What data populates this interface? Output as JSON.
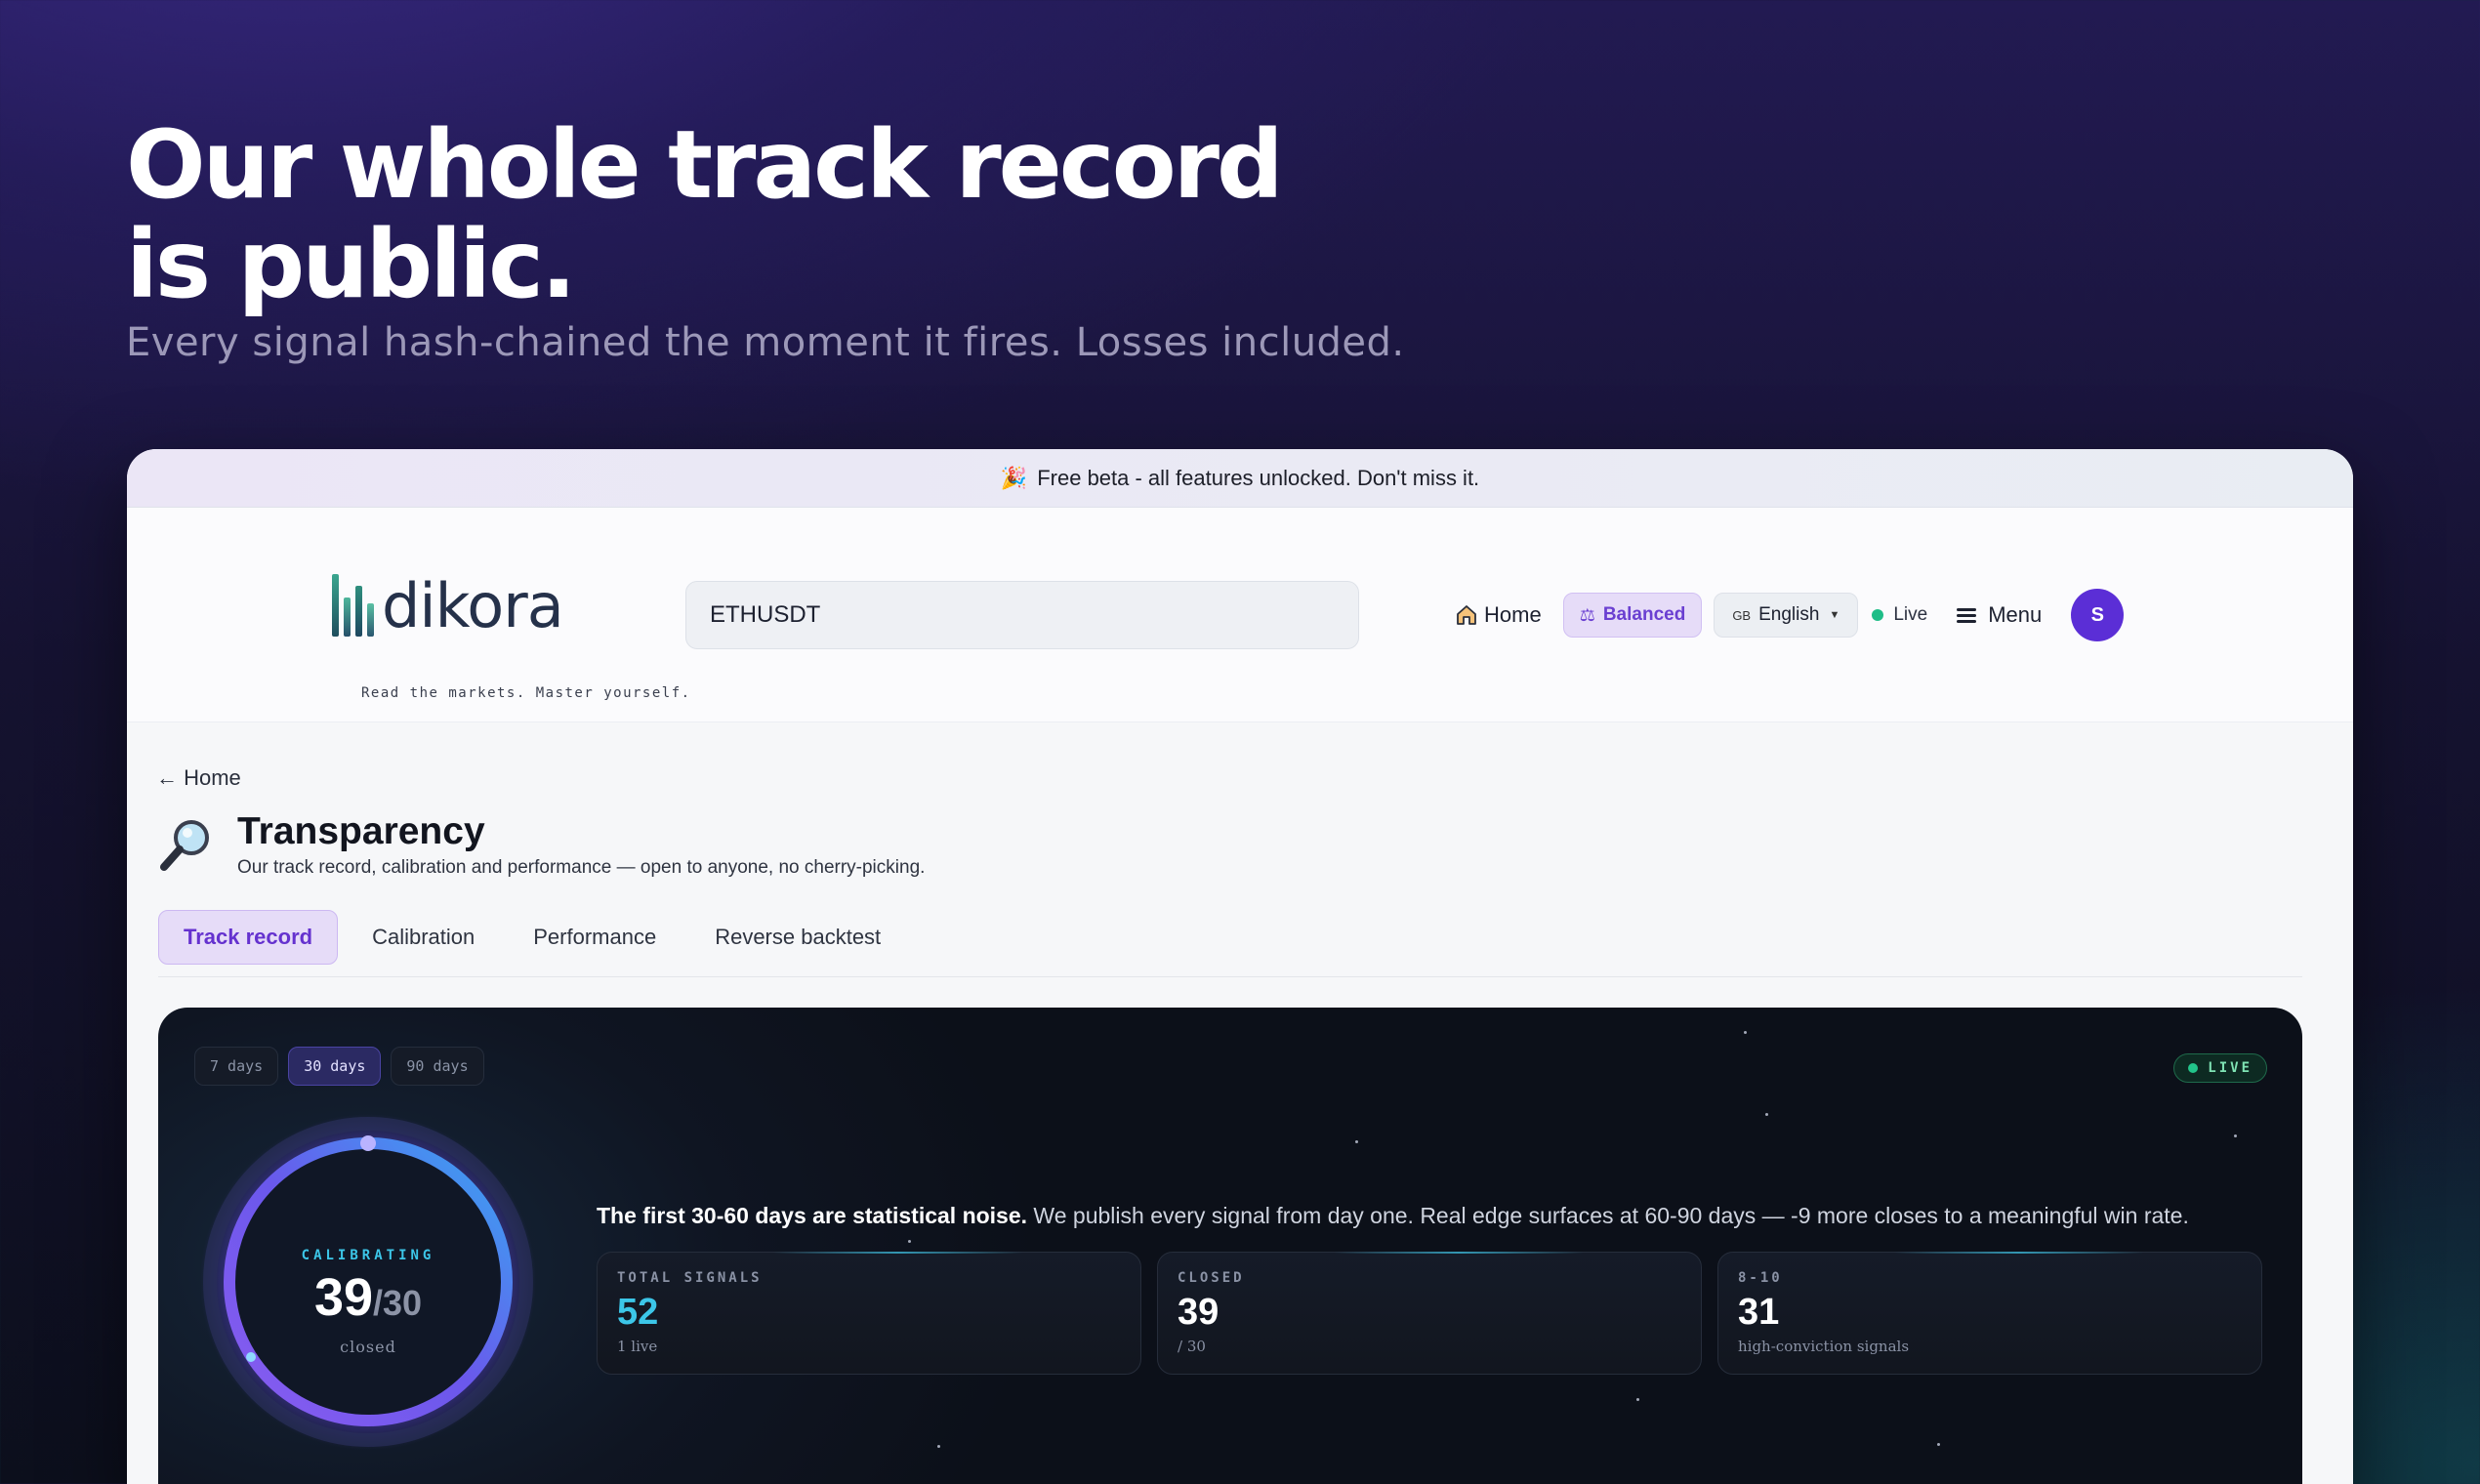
{
  "hero": {
    "title": "Our whole track record\nis public.",
    "subtitle": "Every signal hash-chained the moment it fires. Losses included."
  },
  "banner": {
    "icon": "party-popper-icon",
    "text": "Free beta - all features unlocked. Don't miss it."
  },
  "header": {
    "logo_text": "dikora",
    "tagline": "Read the markets. Master yourself.",
    "search_value": "ETHUSDT",
    "home_label": "Home",
    "mode_label": "Balanced",
    "language_flag": "GB",
    "language_label": "English",
    "live_label": "Live",
    "menu_label": "Menu",
    "avatar_initial": "S"
  },
  "page": {
    "back_label": "← Home",
    "title": "Transparency",
    "subtitle": "Our track record, calibration and performance — open to anyone, no cherry-picking.",
    "tabs": [
      {
        "label": "Track record",
        "active": true
      },
      {
        "label": "Calibration",
        "active": false
      },
      {
        "label": "Performance",
        "active": false
      },
      {
        "label": "Reverse backtest",
        "active": false
      }
    ]
  },
  "panel": {
    "ranges": [
      {
        "label": "7 days",
        "active": false
      },
      {
        "label": "30 days",
        "active": true
      },
      {
        "label": "90 days",
        "active": false
      }
    ],
    "live_badge": "LIVE",
    "gauge": {
      "label": "CALIBRATING",
      "value": "39",
      "target": "/30",
      "caption": "closed",
      "progress": 1.0
    },
    "note_bold": "The first 30-60 days are statistical noise.",
    "note_rest": " We publish every signal from day one. Real edge surfaces at 60-90 days — -9 more closes to a meaningful win rate.",
    "stats": [
      {
        "label": "TOTAL SIGNALS",
        "value": "52",
        "caption": "1 live"
      },
      {
        "label": "CLOSED",
        "value": "39",
        "caption": "/ 30"
      },
      {
        "label": "8-10",
        "value": "31",
        "caption": "high-conviction signals"
      }
    ]
  },
  "colors": {
    "accent_purple": "#6532cf",
    "live_green": "#1ebd87",
    "cyan": "#3cc6e8"
  }
}
